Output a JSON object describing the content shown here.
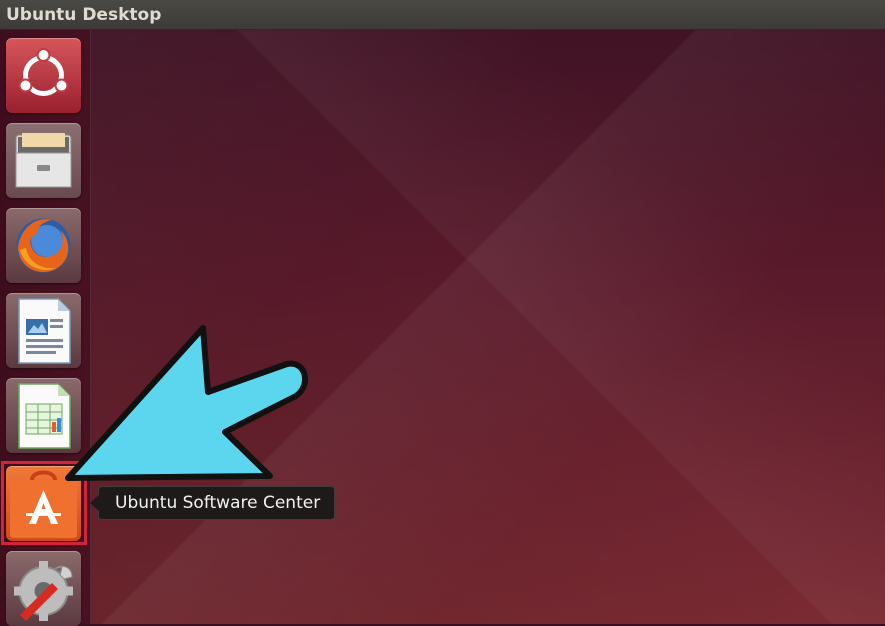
{
  "window": {
    "title": "Ubuntu Desktop"
  },
  "launcher": {
    "items": [
      {
        "name": "Dash Home",
        "icon": "ubuntu-logo-icon"
      },
      {
        "name": "Files",
        "icon": "file-cabinet-icon"
      },
      {
        "name": "Firefox Web Browser",
        "icon": "firefox-icon"
      },
      {
        "name": "LibreOffice Impress",
        "icon": "impress-document-icon"
      },
      {
        "name": "LibreOffice Calc",
        "icon": "calc-spreadsheet-icon"
      },
      {
        "name": "Ubuntu Software Center",
        "icon": "software-center-bag-icon"
      },
      {
        "name": "System Settings",
        "icon": "settings-gear-wrench-icon"
      }
    ]
  },
  "tooltip": {
    "text": "Ubuntu Software Center"
  },
  "colors": {
    "highlight": "#d0253a",
    "pointer_arrow": "#5bd6ee",
    "tooltip_bg": "#1e1a1a"
  }
}
